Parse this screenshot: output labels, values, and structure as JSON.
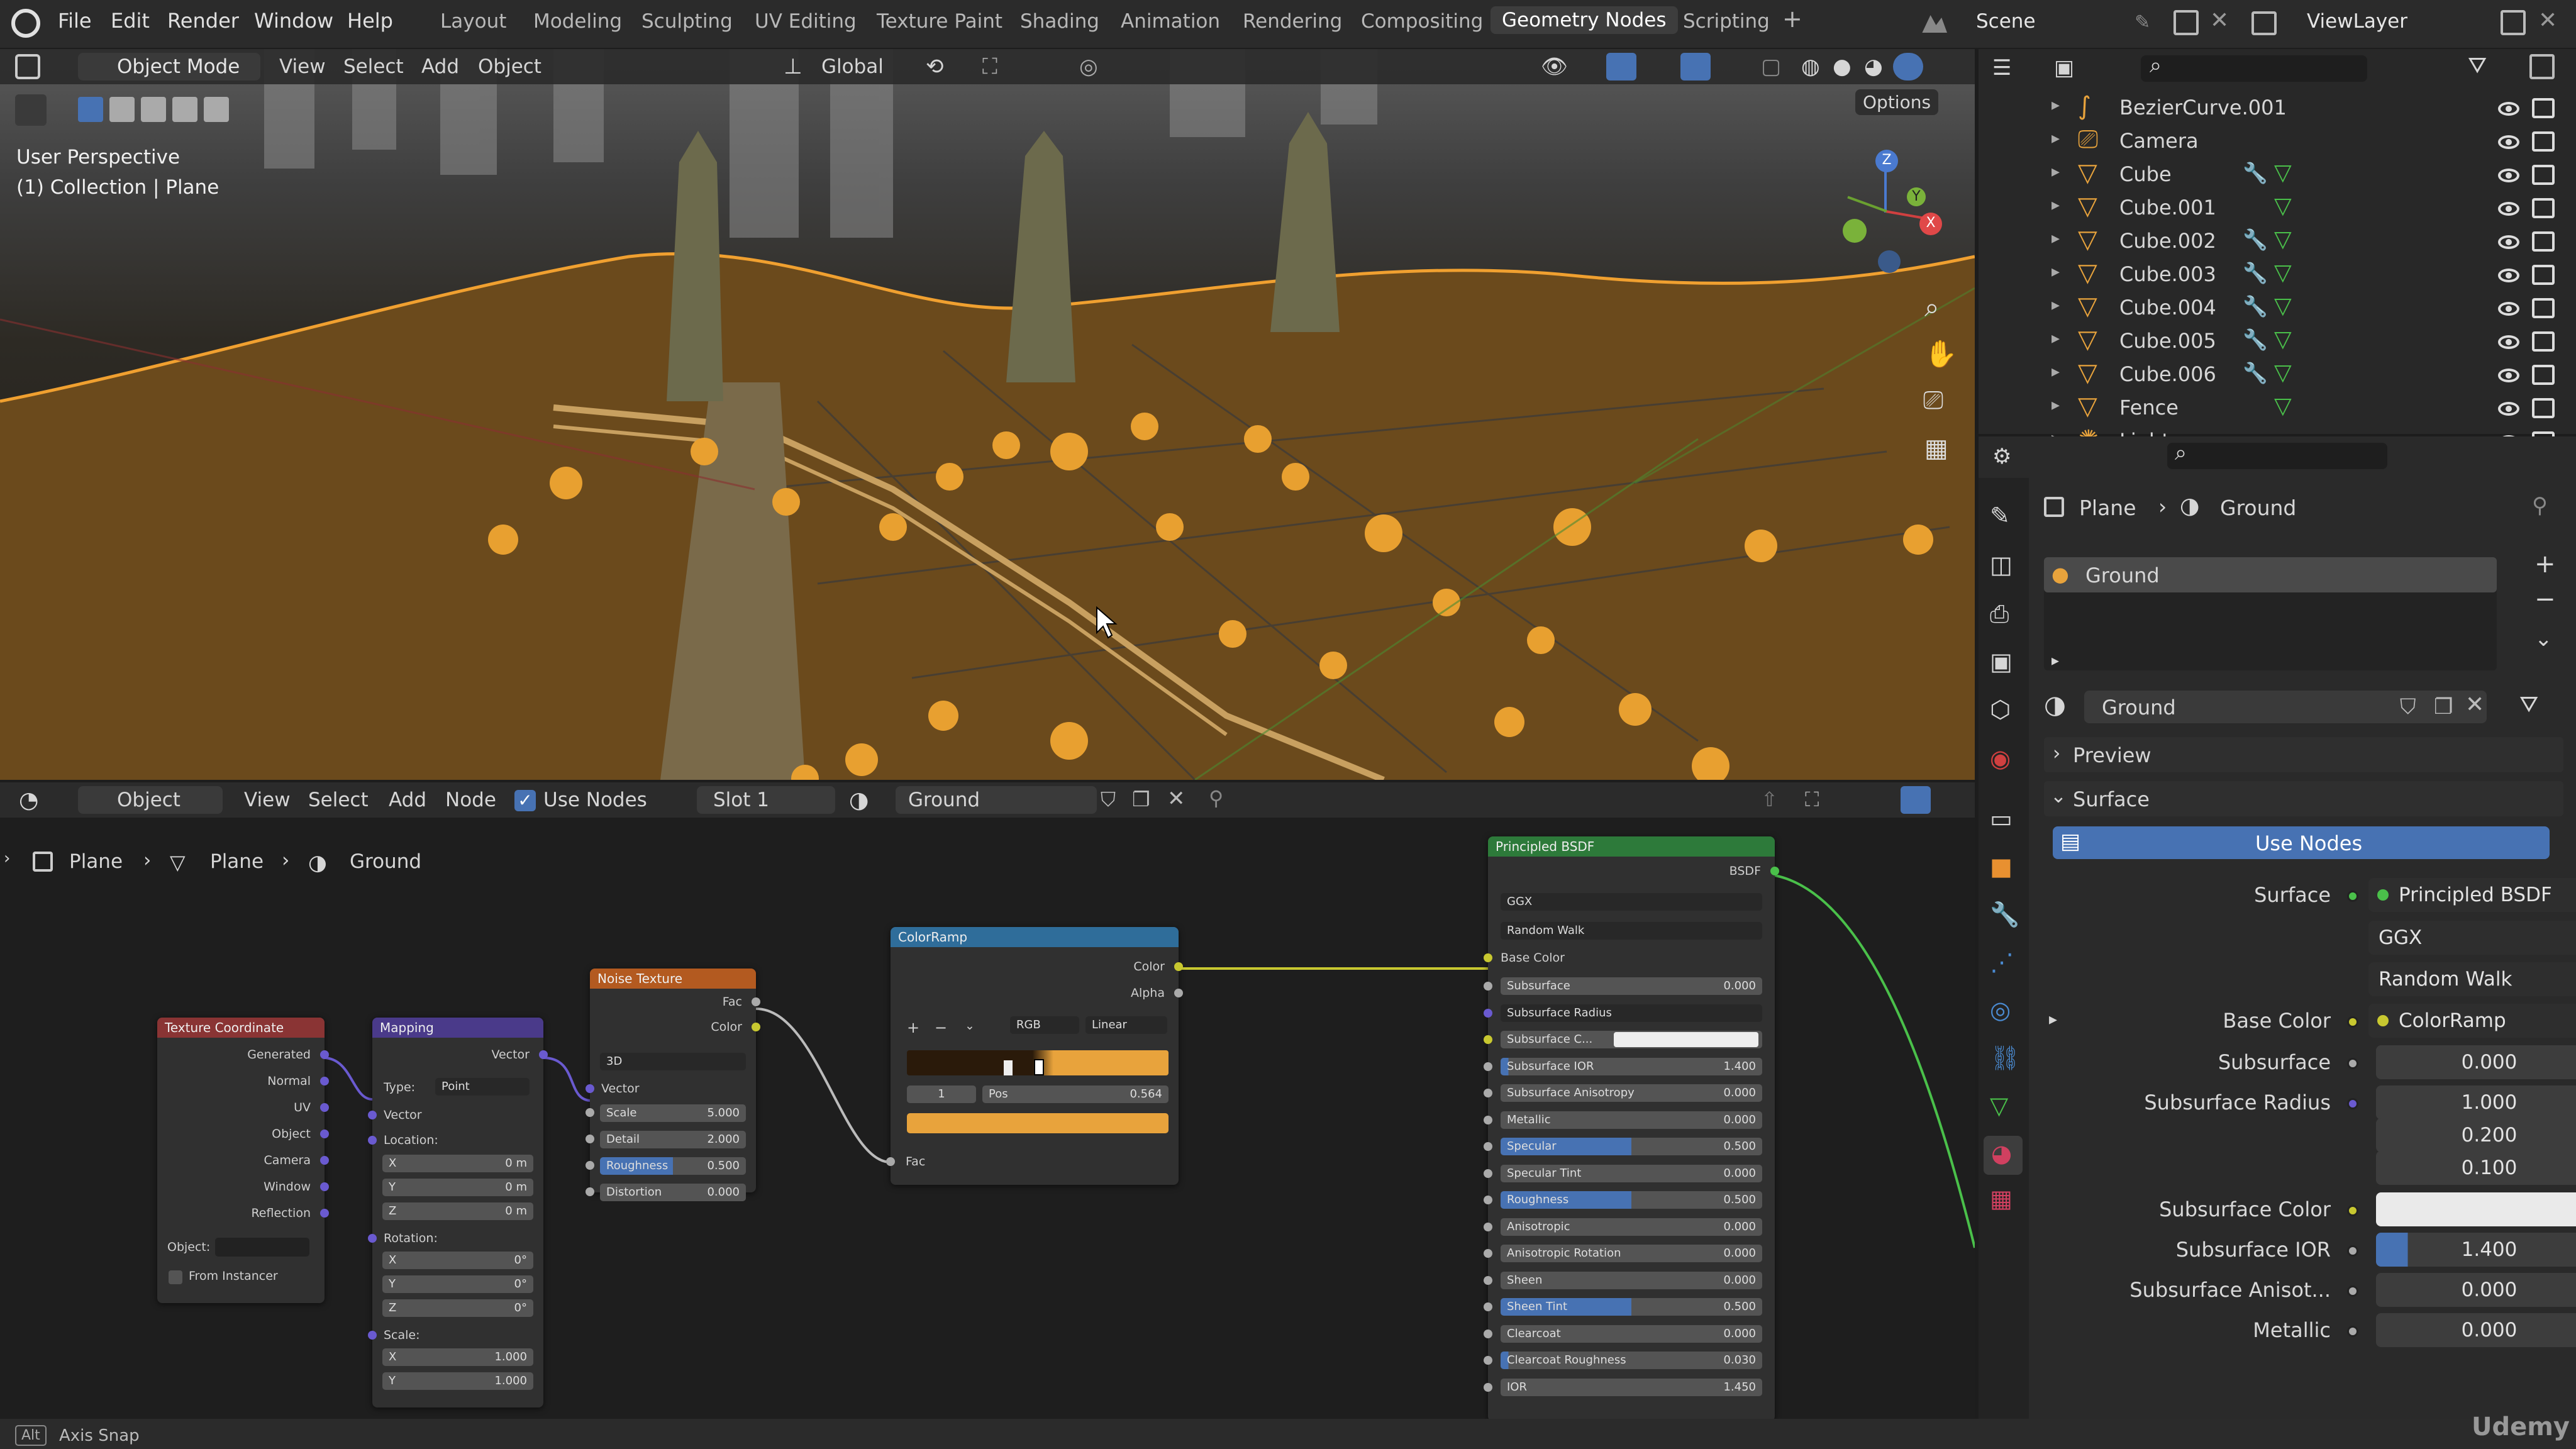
{
  "topbar": {
    "menus": [
      "File",
      "Edit",
      "Render",
      "Window",
      "Help"
    ],
    "workspaces": [
      "Layout",
      "Modeling",
      "Sculpting",
      "UV Editing",
      "Texture Paint",
      "Shading",
      "Animation",
      "Rendering",
      "Compositing",
      "Geometry Nodes",
      "Scripting"
    ],
    "active_workspace": "Geometry Nodes",
    "scene": "Scene",
    "view_layer": "ViewLayer"
  },
  "viewport": {
    "mode": "Object Mode",
    "menus": [
      "View",
      "Select",
      "Add",
      "Object"
    ],
    "transform_orientation": "Global",
    "options_label": "Options",
    "perspective_label": "User Perspective",
    "collection_label": "(1) Collection | Plane",
    "gizmo": {
      "z": "Z",
      "y": "Y",
      "x": "X"
    }
  },
  "node_editor": {
    "mode": "Object",
    "menus": [
      "View",
      "Select",
      "Add",
      "Node"
    ],
    "use_nodes_label": "Use Nodes",
    "slot": "Slot 1",
    "material": "Ground",
    "breadcrumb": [
      "Plane",
      "Plane",
      "Ground"
    ],
    "nodes": {
      "texcoord": {
        "title": "Texture Coordinate",
        "outputs": [
          "Generated",
          "Normal",
          "UV",
          "Object",
          "Camera",
          "Window",
          "Reflection"
        ],
        "object_label": "Object:",
        "from_instancer": "From Instancer"
      },
      "mapping": {
        "title": "Mapping",
        "output": "Vector",
        "type_label": "Type:",
        "type_value": "Point",
        "vector_label": "Vector",
        "location_label": "Location:",
        "loc": [
          [
            "X",
            "0 m"
          ],
          [
            "Y",
            "0 m"
          ],
          [
            "Z",
            "0 m"
          ]
        ],
        "rotation_label": "Rotation:",
        "rot": [
          [
            "X",
            "0°"
          ],
          [
            "Y",
            "0°"
          ],
          [
            "Z",
            "0°"
          ]
        ],
        "scale_label": "Scale:",
        "scale": [
          [
            "X",
            "1.000"
          ],
          [
            "Y",
            "1.000"
          ]
        ]
      },
      "noise": {
        "title": "Noise Texture",
        "outputs": [
          "Fac",
          "Color"
        ],
        "dim": "3D",
        "vector_label": "Vector",
        "fields": [
          [
            "Scale",
            "5.000"
          ],
          [
            "Detail",
            "2.000"
          ],
          [
            "Roughness",
            "0.500"
          ],
          [
            "Distortion",
            "0.000"
          ]
        ]
      },
      "colorramp": {
        "title": "ColorRamp",
        "outputs": [
          "Color",
          "Alpha"
        ],
        "mode": "RGB",
        "interp": "Linear",
        "index": "1",
        "pos_label": "Pos",
        "pos_value": "0.564",
        "fac_label": "Fac"
      },
      "bsdf": {
        "title": "Principled BSDF",
        "output": "BSDF",
        "distribution": "GGX",
        "sss_method": "Random Walk",
        "base_color": "Base Color",
        "fields": [
          [
            "Subsurface",
            "0.000"
          ],
          [
            "Subsurface Radius",
            ""
          ],
          [
            "Subsurface C...",
            ""
          ],
          [
            "Subsurface IOR",
            "1.400"
          ],
          [
            "Subsurface Anisotropy",
            "0.000"
          ],
          [
            "Metallic",
            "0.000"
          ],
          [
            "Specular",
            "0.500"
          ],
          [
            "Specular Tint",
            "0.000"
          ],
          [
            "Roughness",
            "0.500"
          ],
          [
            "Anisotropic",
            "0.000"
          ],
          [
            "Anisotropic Rotation",
            "0.000"
          ],
          [
            "Sheen",
            "0.000"
          ],
          [
            "Sheen Tint",
            "0.500"
          ],
          [
            "Clearcoat",
            "0.000"
          ],
          [
            "Clearcoat Roughness",
            "0.030"
          ],
          [
            "IOR",
            "1.450"
          ]
        ]
      }
    }
  },
  "outliner": {
    "items": [
      {
        "name": "BezierCurve.001",
        "icon": "curve-icon"
      },
      {
        "name": "Camera",
        "icon": "camera-icon"
      },
      {
        "name": "Cube",
        "icon": "mesh-icon"
      },
      {
        "name": "Cube.001",
        "icon": "mesh-icon"
      },
      {
        "name": "Cube.002",
        "icon": "mesh-icon"
      },
      {
        "name": "Cube.003",
        "icon": "mesh-icon"
      },
      {
        "name": "Cube.004",
        "icon": "mesh-icon"
      },
      {
        "name": "Cube.005",
        "icon": "mesh-icon"
      },
      {
        "name": "Cube.006",
        "icon": "mesh-icon"
      },
      {
        "name": "Fence",
        "icon": "mesh-icon"
      },
      {
        "name": "Light",
        "icon": "light-icon"
      }
    ]
  },
  "properties": {
    "breadcrumb": [
      "Plane",
      "Ground"
    ],
    "slot_material": "Ground",
    "material_name": "Ground",
    "preview_label": "Preview",
    "surface_label": "Surface",
    "use_nodes_label": "Use Nodes",
    "rows": [
      {
        "label": "Surface",
        "value": "Principled BSDF"
      },
      {
        "label": "",
        "value": "GGX"
      },
      {
        "label": "",
        "value": "Random Walk"
      },
      {
        "label": "Base Color",
        "value": "ColorRamp"
      },
      {
        "label": "Subsurface",
        "value": "0.000"
      },
      {
        "label": "Subsurface Radius",
        "value": "1.000"
      },
      {
        "label": "",
        "value": "0.200"
      },
      {
        "label": "",
        "value": "0.100"
      },
      {
        "label": "Subsurface Color",
        "value": ""
      },
      {
        "label": "Subsurface IOR",
        "value": "1.400"
      },
      {
        "label": "Subsurface Anisot...",
        "value": "0.000"
      },
      {
        "label": "Metallic",
        "value": "0.000"
      }
    ]
  },
  "status": {
    "key": "Alt",
    "text": "Axis Snap",
    "watermark": "Udemy"
  },
  "colors": {
    "accent": "#4772b3",
    "orange": "#e8a33c",
    "node_green": "#2d7a3a",
    "node_purple": "#4a3a8a",
    "node_orange": "#b35a20",
    "node_blue": "#2f6d9a",
    "node_red": "#8a3434"
  }
}
